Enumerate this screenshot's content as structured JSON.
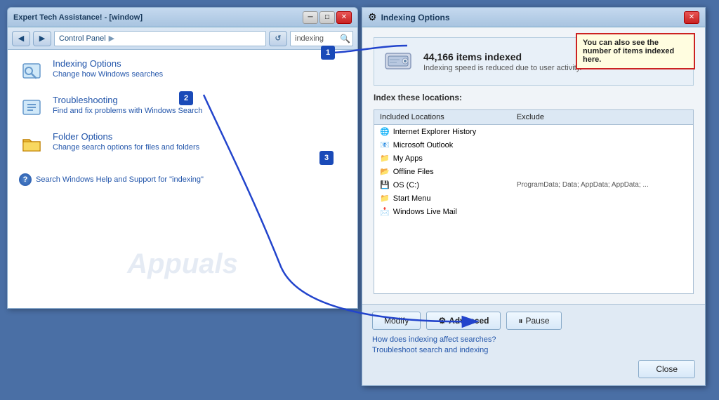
{
  "left_window": {
    "title": "Expert Tech Assistance! - [window]",
    "breadcrumb": "Control Panel",
    "search_placeholder": "indexing",
    "results": [
      {
        "id": "indexing-options",
        "title": "Indexing Options",
        "description": "Change how Windows searches",
        "icon": "control-panel-search"
      },
      {
        "id": "troubleshooting",
        "title": "Troubleshooting",
        "description": "Find and fix problems with Windows Search",
        "icon": "wrench"
      },
      {
        "id": "folder-options",
        "title": "Folder Options",
        "description": "Change search options for files and folders",
        "icon": "folder"
      }
    ],
    "help_text": "Search Windows Help and Support for \"indexing\"",
    "watermark": "Appuals"
  },
  "right_dialog": {
    "title": "Indexing Options",
    "items_indexed": "44,166 items indexed",
    "indexing_speed": "Indexing speed is reduced due to user activity.",
    "callout_text": "You can also see the number of items indexed here.",
    "index_these_label": "Index these locations:",
    "table_headers": [
      "Included Locations",
      "Exclude"
    ],
    "locations": [
      {
        "name": "Internet Explorer History",
        "exclude": "",
        "icon": "ie"
      },
      {
        "name": "Microsoft Outlook",
        "exclude": "",
        "icon": "outlook"
      },
      {
        "name": "My Apps",
        "exclude": "",
        "icon": "folder"
      },
      {
        "name": "Offline Files",
        "exclude": "",
        "icon": "offline"
      },
      {
        "name": "OS (C:)",
        "exclude": "ProgramData; Data; AppData; AppData; ...",
        "icon": "hdd"
      },
      {
        "name": "Start Menu",
        "exclude": "",
        "icon": "folder"
      },
      {
        "name": "Windows Live Mail",
        "exclude": "",
        "icon": "mail"
      }
    ],
    "buttons": {
      "modify": "Modify",
      "advanced": "Advanced",
      "pause": "Pause"
    },
    "links": [
      "How does indexing affect searches?",
      "Troubleshoot search and indexing"
    ],
    "close_label": "Close"
  },
  "annotations": {
    "badge1": "1",
    "badge2": "2",
    "badge3": "3"
  }
}
